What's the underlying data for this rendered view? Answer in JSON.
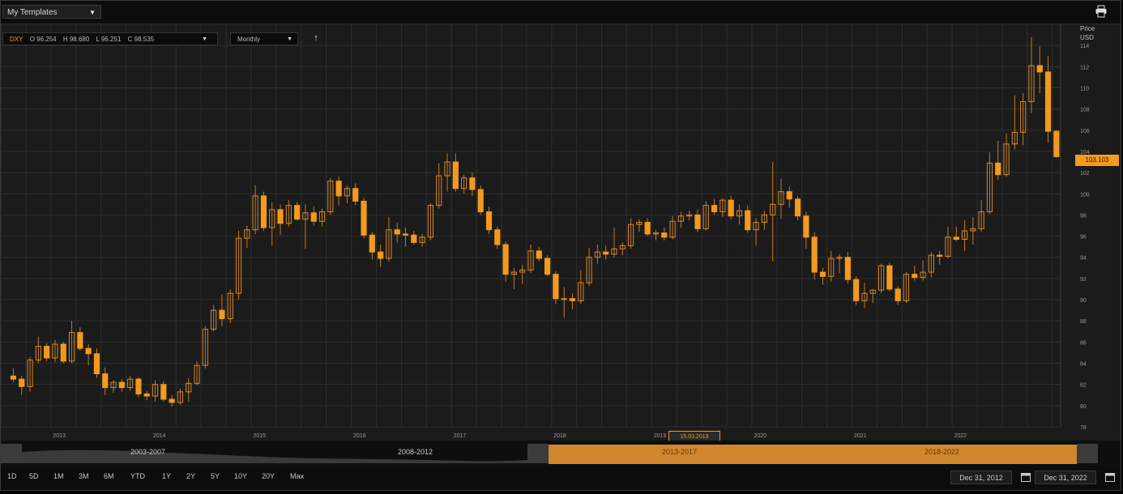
{
  "header": {
    "templates_label": "My Templates",
    "dropdown_caret": "▼"
  },
  "ohlc": {
    "symbol": "DXY",
    "open": "O 96.254",
    "high": "H 98.680",
    "low": "L 96.251",
    "close": "C 98.535"
  },
  "interval": {
    "label": "Monthly"
  },
  "axis": {
    "right_title_1": "Price",
    "right_title_2": "USD",
    "y_ticks": [
      {
        "label": "114",
        "value": 114
      },
      {
        "label": "112",
        "value": 112
      },
      {
        "label": "110",
        "value": 110
      },
      {
        "label": "108",
        "value": 108
      },
      {
        "label": "106",
        "value": 106
      },
      {
        "label": "104",
        "value": 104
      },
      {
        "label": "102",
        "value": 102
      },
      {
        "label": "100",
        "value": 100
      },
      {
        "label": "98",
        "value": 98
      },
      {
        "label": "96",
        "value": 96
      },
      {
        "label": "94",
        "value": 94
      },
      {
        "label": "92",
        "value": 92
      },
      {
        "label": "90",
        "value": 90
      },
      {
        "label": "88",
        "value": 88
      },
      {
        "label": "86",
        "value": 86
      },
      {
        "label": "84",
        "value": 84
      },
      {
        "label": "82",
        "value": 82
      },
      {
        "label": "80",
        "value": 80
      },
      {
        "label": "78",
        "value": 78
      }
    ],
    "x_ticks": [
      "2013",
      "2014",
      "2015",
      "2016",
      "2017",
      "2018",
      "2019",
      "2020",
      "2021",
      "2022"
    ]
  },
  "last_price_label": "103.103",
  "hover_date_label": "15.03.2019",
  "navigator": {
    "periods": [
      "2003-2007",
      "2008-2012",
      "2013-2017",
      "2018-2022"
    ]
  },
  "range_buttons": [
    "1D",
    "5D",
    "1M",
    "3M",
    "6M",
    "YTD",
    "1Y",
    "2Y",
    "5Y",
    "10Y",
    "20Y",
    "Max"
  ],
  "date_range": {
    "from": "Dec 31, 2012",
    "to": "Dec 31, 2022"
  },
  "colors": {
    "up": "#f39a1e",
    "down": "#f39a1e",
    "accent": "#f39a1e",
    "background": "#1b1b1b",
    "grid": "#2f2f2f"
  },
  "chart_data": {
    "type": "candlestick",
    "x_axis": "Date",
    "y_axis_unit": "USD",
    "ylim": [
      78,
      116
    ],
    "xlim": [
      "2012-06",
      "2022-12"
    ],
    "grid": true,
    "series": [
      {
        "date": "2012-07",
        "open": 82.8,
        "high": 83.5,
        "low": 82.2,
        "close": 82.5
      },
      {
        "date": "2012-08",
        "open": 82.5,
        "high": 82.8,
        "low": 81.0,
        "close": 81.8
      },
      {
        "date": "2012-09",
        "open": 81.8,
        "high": 84.6,
        "low": 81.3,
        "close": 84.3
      },
      {
        "date": "2012-10",
        "open": 84.3,
        "high": 86.5,
        "low": 84.0,
        "close": 85.6
      },
      {
        "date": "2012-11",
        "open": 85.6,
        "high": 85.9,
        "low": 84.2,
        "close": 84.5
      },
      {
        "date": "2012-12",
        "open": 84.5,
        "high": 86.2,
        "low": 84.1,
        "close": 85.8
      },
      {
        "date": "2013-01",
        "open": 85.8,
        "high": 86.0,
        "low": 84.0,
        "close": 84.2
      },
      {
        "date": "2013-02",
        "open": 84.2,
        "high": 88.0,
        "low": 84.0,
        "close": 86.9
      },
      {
        "date": "2013-03",
        "open": 86.9,
        "high": 87.4,
        "low": 85.2,
        "close": 85.4
      },
      {
        "date": "2013-04",
        "open": 85.4,
        "high": 85.8,
        "low": 83.8,
        "close": 84.9
      },
      {
        "date": "2013-05",
        "open": 84.9,
        "high": 85.4,
        "low": 82.6,
        "close": 83.0
      },
      {
        "date": "2013-06",
        "open": 83.0,
        "high": 83.6,
        "low": 81.0,
        "close": 81.7
      },
      {
        "date": "2013-07",
        "open": 81.7,
        "high": 82.4,
        "low": 81.2,
        "close": 82.2
      },
      {
        "date": "2013-08",
        "open": 82.2,
        "high": 82.5,
        "low": 81.3,
        "close": 81.7
      },
      {
        "date": "2013-09",
        "open": 81.7,
        "high": 82.8,
        "low": 81.4,
        "close": 82.5
      },
      {
        "date": "2013-10",
        "open": 82.5,
        "high": 82.7,
        "low": 80.8,
        "close": 81.1
      },
      {
        "date": "2013-11",
        "open": 81.1,
        "high": 81.4,
        "low": 80.5,
        "close": 80.9
      },
      {
        "date": "2013-12",
        "open": 80.9,
        "high": 82.4,
        "low": 80.4,
        "close": 82.0
      },
      {
        "date": "2014-01",
        "open": 82.0,
        "high": 82.3,
        "low": 80.4,
        "close": 80.6
      },
      {
        "date": "2014-02",
        "open": 80.6,
        "high": 81.0,
        "low": 79.9,
        "close": 80.3
      },
      {
        "date": "2014-03",
        "open": 80.3,
        "high": 81.6,
        "low": 80.1,
        "close": 81.3
      },
      {
        "date": "2014-04",
        "open": 81.3,
        "high": 82.6,
        "low": 80.4,
        "close": 82.1
      },
      {
        "date": "2014-05",
        "open": 82.1,
        "high": 84.2,
        "low": 81.9,
        "close": 83.8
      },
      {
        "date": "2014-06",
        "open": 83.8,
        "high": 87.5,
        "low": 83.5,
        "close": 87.2
      },
      {
        "date": "2014-07",
        "open": 87.2,
        "high": 89.5,
        "low": 87.0,
        "close": 89.0
      },
      {
        "date": "2014-08",
        "open": 89.0,
        "high": 90.5,
        "low": 87.5,
        "close": 88.2
      },
      {
        "date": "2014-09",
        "open": 88.2,
        "high": 91.0,
        "low": 87.8,
        "close": 90.6
      },
      {
        "date": "2014-10",
        "open": 90.6,
        "high": 96.5,
        "low": 90.0,
        "close": 95.8
      },
      {
        "date": "2014-11",
        "open": 95.8,
        "high": 97.0,
        "low": 94.9,
        "close": 96.6
      },
      {
        "date": "2014-12",
        "open": 96.6,
        "high": 100.8,
        "low": 96.2,
        "close": 99.8
      },
      {
        "date": "2015-01",
        "open": 99.8,
        "high": 100.2,
        "low": 96.5,
        "close": 96.8
      },
      {
        "date": "2015-02",
        "open": 96.8,
        "high": 99.2,
        "low": 95.1,
        "close": 98.5
      },
      {
        "date": "2015-03",
        "open": 98.5,
        "high": 99.0,
        "low": 96.1,
        "close": 97.2
      },
      {
        "date": "2015-04",
        "open": 97.2,
        "high": 99.4,
        "low": 96.9,
        "close": 98.9
      },
      {
        "date": "2015-05",
        "open": 98.9,
        "high": 99.2,
        "low": 97.5,
        "close": 97.6
      },
      {
        "date": "2015-06",
        "open": 97.6,
        "high": 99.0,
        "low": 94.8,
        "close": 98.2
      },
      {
        "date": "2015-07",
        "open": 98.2,
        "high": 98.8,
        "low": 97.0,
        "close": 97.4
      },
      {
        "date": "2015-08",
        "open": 97.4,
        "high": 98.6,
        "low": 96.9,
        "close": 98.3
      },
      {
        "date": "2015-09",
        "open": 98.3,
        "high": 101.5,
        "low": 98.0,
        "close": 101.2
      },
      {
        "date": "2015-10",
        "open": 101.2,
        "high": 101.6,
        "low": 98.9,
        "close": 99.8
      },
      {
        "date": "2015-11",
        "open": 99.8,
        "high": 100.8,
        "low": 99.1,
        "close": 100.5
      },
      {
        "date": "2015-12",
        "open": 100.5,
        "high": 101.0,
        "low": 98.9,
        "close": 99.3
      },
      {
        "date": "2016-01",
        "open": 99.3,
        "high": 99.6,
        "low": 95.8,
        "close": 96.1
      },
      {
        "date": "2016-02",
        "open": 96.1,
        "high": 96.4,
        "low": 93.8,
        "close": 94.5
      },
      {
        "date": "2016-03",
        "open": 94.5,
        "high": 95.2,
        "low": 93.1,
        "close": 93.9
      },
      {
        "date": "2016-04",
        "open": 93.9,
        "high": 97.8,
        "low": 93.6,
        "close": 96.6
      },
      {
        "date": "2016-05",
        "open": 96.6,
        "high": 97.3,
        "low": 95.4,
        "close": 96.2
      },
      {
        "date": "2016-06",
        "open": 96.2,
        "high": 96.8,
        "low": 95.0,
        "close": 96.1
      },
      {
        "date": "2016-07",
        "open": 96.1,
        "high": 96.5,
        "low": 95.2,
        "close": 95.4
      },
      {
        "date": "2016-08",
        "open": 95.4,
        "high": 96.2,
        "low": 95.0,
        "close": 95.9
      },
      {
        "date": "2016-09",
        "open": 95.9,
        "high": 99.1,
        "low": 95.6,
        "close": 98.9
      },
      {
        "date": "2016-10",
        "open": 98.9,
        "high": 102.9,
        "low": 98.6,
        "close": 101.7
      },
      {
        "date": "2016-11",
        "open": 101.7,
        "high": 103.8,
        "low": 100.2,
        "close": 103.0
      },
      {
        "date": "2016-12",
        "open": 103.0,
        "high": 103.8,
        "low": 100.2,
        "close": 100.5
      },
      {
        "date": "2017-01",
        "open": 100.5,
        "high": 101.8,
        "low": 100.0,
        "close": 101.5
      },
      {
        "date": "2017-02",
        "open": 101.5,
        "high": 102.0,
        "low": 99.8,
        "close": 100.4
      },
      {
        "date": "2017-03",
        "open": 100.4,
        "high": 100.8,
        "low": 98.0,
        "close": 98.3
      },
      {
        "date": "2017-04",
        "open": 98.3,
        "high": 98.8,
        "low": 96.2,
        "close": 96.6
      },
      {
        "date": "2017-05",
        "open": 96.6,
        "high": 96.9,
        "low": 94.8,
        "close": 95.2
      },
      {
        "date": "2017-06",
        "open": 95.2,
        "high": 95.5,
        "low": 91.7,
        "close": 92.4
      },
      {
        "date": "2017-07",
        "open": 92.4,
        "high": 93.0,
        "low": 91.0,
        "close": 92.6
      },
      {
        "date": "2017-08",
        "open": 92.6,
        "high": 93.3,
        "low": 91.5,
        "close": 92.8
      },
      {
        "date": "2017-09",
        "open": 92.8,
        "high": 95.2,
        "low": 92.5,
        "close": 94.6
      },
      {
        "date": "2017-10",
        "open": 94.6,
        "high": 95.0,
        "low": 93.6,
        "close": 93.9
      },
      {
        "date": "2017-11",
        "open": 93.9,
        "high": 94.2,
        "low": 92.2,
        "close": 92.4
      },
      {
        "date": "2017-12",
        "open": 92.4,
        "high": 92.7,
        "low": 89.6,
        "close": 90.1
      },
      {
        "date": "2018-01",
        "open": 90.1,
        "high": 91.2,
        "low": 88.3,
        "close": 90.1
      },
      {
        "date": "2018-02",
        "open": 90.1,
        "high": 90.6,
        "low": 89.1,
        "close": 89.9
      },
      {
        "date": "2018-03",
        "open": 89.9,
        "high": 92.8,
        "low": 89.6,
        "close": 91.6
      },
      {
        "date": "2018-04",
        "open": 91.6,
        "high": 94.9,
        "low": 91.3,
        "close": 94.0
      },
      {
        "date": "2018-05",
        "open": 94.0,
        "high": 95.2,
        "low": 93.4,
        "close": 94.5
      },
      {
        "date": "2018-06",
        "open": 94.5,
        "high": 95.1,
        "low": 93.8,
        "close": 94.3
      },
      {
        "date": "2018-07",
        "open": 94.3,
        "high": 96.8,
        "low": 94.0,
        "close": 94.8
      },
      {
        "date": "2018-08",
        "open": 94.8,
        "high": 95.4,
        "low": 94.2,
        "close": 95.1
      },
      {
        "date": "2018-09",
        "open": 95.1,
        "high": 97.7,
        "low": 94.8,
        "close": 97.1
      },
      {
        "date": "2018-10",
        "open": 97.1,
        "high": 97.6,
        "low": 96.4,
        "close": 97.3
      },
      {
        "date": "2018-11",
        "open": 97.3,
        "high": 97.7,
        "low": 96.0,
        "close": 96.2
      },
      {
        "date": "2018-12",
        "open": 96.2,
        "high": 96.6,
        "low": 95.6,
        "close": 96.3
      },
      {
        "date": "2019-01",
        "open": 96.3,
        "high": 96.8,
        "low": 95.6,
        "close": 95.9
      },
      {
        "date": "2019-02",
        "open": 95.9,
        "high": 97.9,
        "low": 95.7,
        "close": 97.4
      },
      {
        "date": "2019-03",
        "open": 97.4,
        "high": 98.3,
        "low": 96.8,
        "close": 97.9
      },
      {
        "date": "2019-04",
        "open": 97.9,
        "high": 98.4,
        "low": 97.5,
        "close": 98.0
      },
      {
        "date": "2019-05",
        "open": 98.0,
        "high": 98.5,
        "low": 96.4,
        "close": 96.7
      },
      {
        "date": "2019-06",
        "open": 96.7,
        "high": 99.3,
        "low": 96.5,
        "close": 98.9
      },
      {
        "date": "2019-07",
        "open": 98.9,
        "high": 99.5,
        "low": 98.0,
        "close": 98.3
      },
      {
        "date": "2019-08",
        "open": 98.3,
        "high": 99.6,
        "low": 97.8,
        "close": 99.4
      },
      {
        "date": "2019-09",
        "open": 99.4,
        "high": 99.8,
        "low": 97.6,
        "close": 97.9
      },
      {
        "date": "2019-10",
        "open": 97.9,
        "high": 99.0,
        "low": 97.1,
        "close": 98.4
      },
      {
        "date": "2019-11",
        "open": 98.4,
        "high": 98.9,
        "low": 96.3,
        "close": 96.6
      },
      {
        "date": "2019-12",
        "open": 96.6,
        "high": 97.7,
        "low": 95.1,
        "close": 97.3
      },
      {
        "date": "2020-01",
        "open": 97.3,
        "high": 98.4,
        "low": 96.6,
        "close": 98.0
      },
      {
        "date": "2020-02",
        "open": 98.0,
        "high": 103.0,
        "low": 93.6,
        "close": 99.0
      },
      {
        "date": "2020-03",
        "open": 99.0,
        "high": 101.4,
        "low": 97.6,
        "close": 100.2
      },
      {
        "date": "2020-04",
        "open": 100.2,
        "high": 100.7,
        "low": 98.7,
        "close": 99.5
      },
      {
        "date": "2020-05",
        "open": 99.5,
        "high": 99.8,
        "low": 97.5,
        "close": 97.9
      },
      {
        "date": "2020-06",
        "open": 97.9,
        "high": 98.3,
        "low": 94.8,
        "close": 95.9
      },
      {
        "date": "2020-07",
        "open": 95.9,
        "high": 96.4,
        "low": 91.9,
        "close": 92.6
      },
      {
        "date": "2020-08",
        "open": 92.6,
        "high": 93.0,
        "low": 91.4,
        "close": 92.2
      },
      {
        "date": "2020-09",
        "open": 92.2,
        "high": 94.6,
        "low": 91.7,
        "close": 93.9
      },
      {
        "date": "2020-10",
        "open": 93.9,
        "high": 94.3,
        "low": 92.5,
        "close": 94.0
      },
      {
        "date": "2020-11",
        "open": 94.0,
        "high": 94.5,
        "low": 91.5,
        "close": 91.9
      },
      {
        "date": "2020-12",
        "open": 91.9,
        "high": 92.2,
        "low": 89.5,
        "close": 89.9
      },
      {
        "date": "2021-01",
        "open": 89.9,
        "high": 91.6,
        "low": 89.2,
        "close": 90.6
      },
      {
        "date": "2021-02",
        "open": 90.6,
        "high": 91.0,
        "low": 89.7,
        "close": 90.9
      },
      {
        "date": "2021-03",
        "open": 90.9,
        "high": 93.4,
        "low": 90.6,
        "close": 93.2
      },
      {
        "date": "2021-04",
        "open": 93.2,
        "high": 93.5,
        "low": 90.8,
        "close": 91.0
      },
      {
        "date": "2021-05",
        "open": 91.0,
        "high": 91.3,
        "low": 89.5,
        "close": 89.9
      },
      {
        "date": "2021-06",
        "open": 89.9,
        "high": 92.6,
        "low": 89.7,
        "close": 92.4
      },
      {
        "date": "2021-07",
        "open": 92.4,
        "high": 93.2,
        "low": 91.8,
        "close": 92.1
      },
      {
        "date": "2021-08",
        "open": 92.1,
        "high": 93.7,
        "low": 91.8,
        "close": 92.6
      },
      {
        "date": "2021-09",
        "open": 92.6,
        "high": 94.5,
        "low": 92.1,
        "close": 94.2
      },
      {
        "date": "2021-10",
        "open": 94.2,
        "high": 94.6,
        "low": 93.3,
        "close": 94.1
      },
      {
        "date": "2021-11",
        "open": 94.1,
        "high": 96.9,
        "low": 93.9,
        "close": 95.9
      },
      {
        "date": "2021-12",
        "open": 95.9,
        "high": 96.9,
        "low": 95.5,
        "close": 95.7
      },
      {
        "date": "2022-01",
        "open": 95.7,
        "high": 97.5,
        "low": 94.6,
        "close": 96.5
      },
      {
        "date": "2022-02",
        "open": 96.5,
        "high": 97.8,
        "low": 95.2,
        "close": 96.7
      },
      {
        "date": "2022-03",
        "open": 96.7,
        "high": 99.4,
        "low": 96.4,
        "close": 98.3
      },
      {
        "date": "2022-04",
        "open": 98.3,
        "high": 103.9,
        "low": 98.1,
        "close": 102.9
      },
      {
        "date": "2022-05",
        "open": 102.9,
        "high": 105.0,
        "low": 101.3,
        "close": 101.8
      },
      {
        "date": "2022-06",
        "open": 101.8,
        "high": 105.7,
        "low": 101.6,
        "close": 104.7
      },
      {
        "date": "2022-07",
        "open": 104.7,
        "high": 109.3,
        "low": 104.2,
        "close": 105.8
      },
      {
        "date": "2022-08",
        "open": 105.8,
        "high": 109.5,
        "low": 104.6,
        "close": 108.7
      },
      {
        "date": "2022-09",
        "open": 108.7,
        "high": 114.8,
        "low": 107.6,
        "close": 112.1
      },
      {
        "date": "2022-10",
        "open": 112.1,
        "high": 113.9,
        "low": 109.5,
        "close": 111.5
      },
      {
        "date": "2022-11",
        "open": 111.5,
        "high": 113.0,
        "low": 104.8,
        "close": 105.9
      },
      {
        "date": "2022-12",
        "open": 105.9,
        "high": 106.0,
        "low": 103.4,
        "close": 103.5
      }
    ]
  }
}
